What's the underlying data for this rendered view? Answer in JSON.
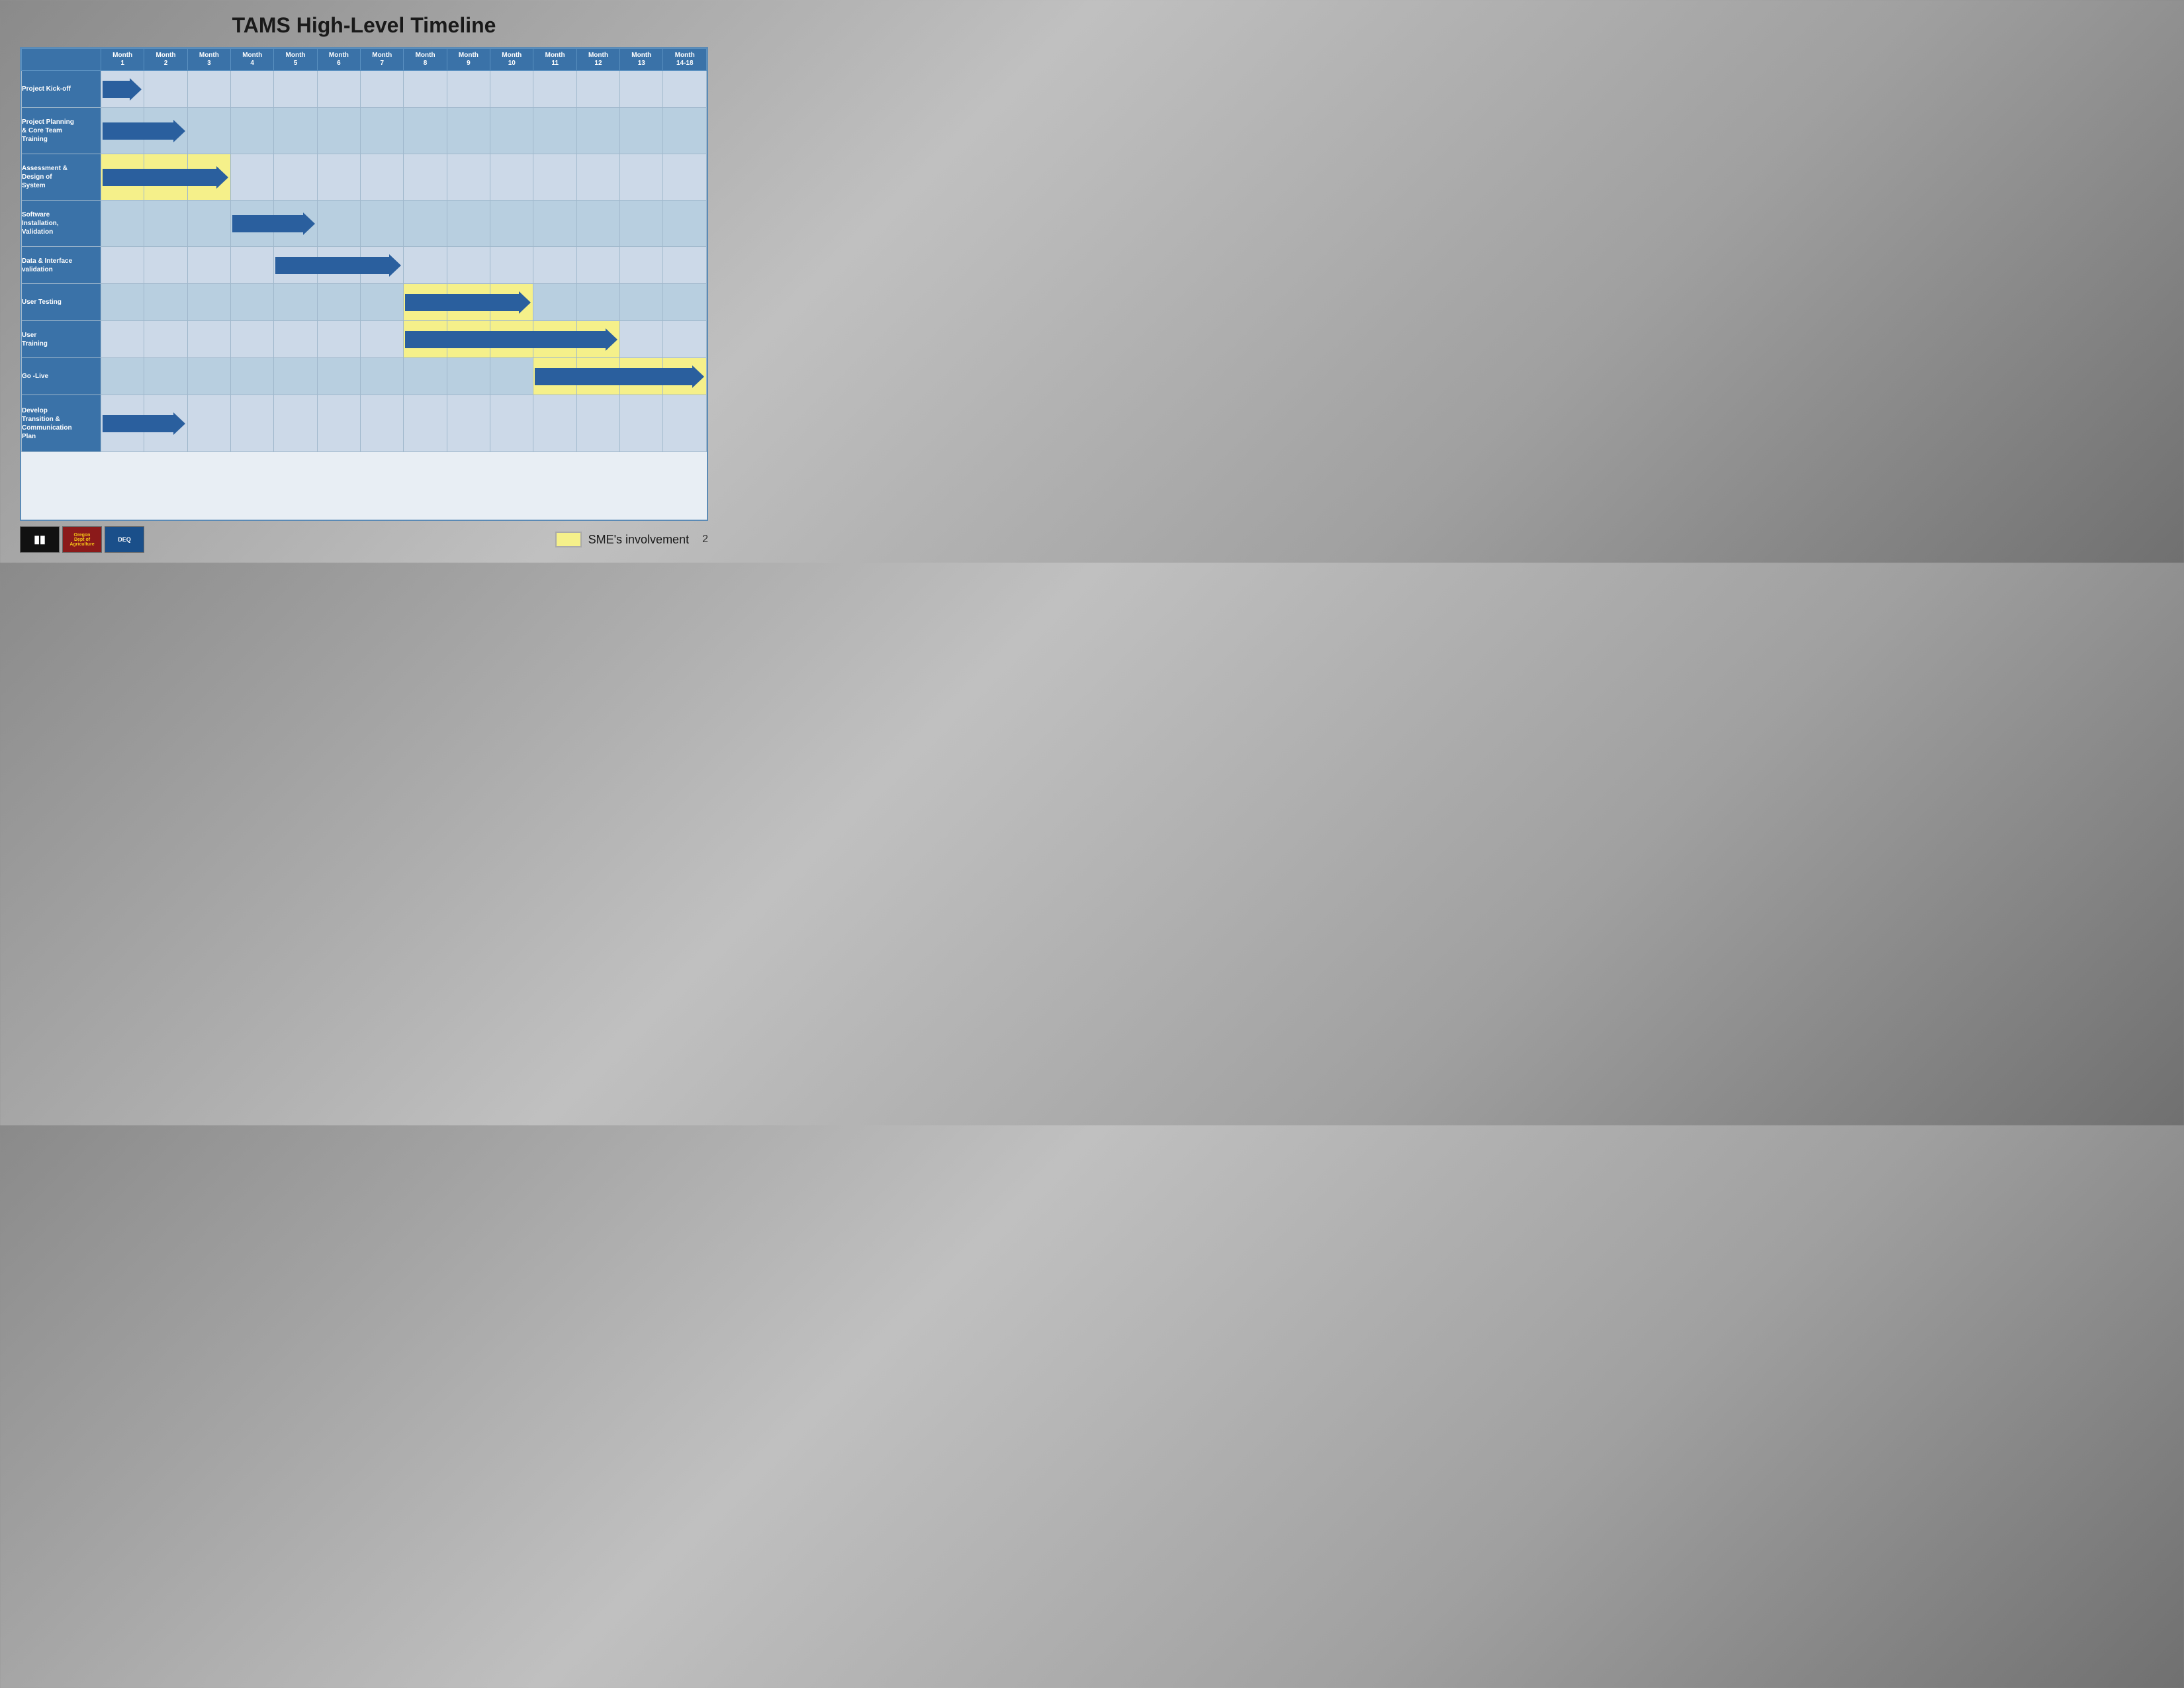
{
  "title": "TAMS High-Level Timeline",
  "months": [
    {
      "label": "Month",
      "sub": "1"
    },
    {
      "label": "Month",
      "sub": "2"
    },
    {
      "label": "Month",
      "sub": "3"
    },
    {
      "label": "Month",
      "sub": "4"
    },
    {
      "label": "Month",
      "sub": "5"
    },
    {
      "label": "Month",
      "sub": "6"
    },
    {
      "label": "Month",
      "sub": "7"
    },
    {
      "label": "Month",
      "sub": "8"
    },
    {
      "label": "Month",
      "sub": "9"
    },
    {
      "label": "Month",
      "sub": "10"
    },
    {
      "label": "Month",
      "sub": "11"
    },
    {
      "label": "Month",
      "sub": "12"
    },
    {
      "label": "Month",
      "sub": "13"
    },
    {
      "label": "Month",
      "sub": "14-18"
    }
  ],
  "rows": [
    {
      "label": "Project Kick-off",
      "arrow_start": 0,
      "arrow_span": 1,
      "yellow": [],
      "height": "normal"
    },
    {
      "label": "Project Planning\n& Core Team\nTraining",
      "arrow_start": 0,
      "arrow_span": 2,
      "yellow": [],
      "height": "tall"
    },
    {
      "label": "Assessment &\nDesign of\nSystem",
      "arrow_start": 0,
      "arrow_span": 3,
      "yellow": [
        0,
        1,
        2
      ],
      "height": "tall"
    },
    {
      "label": "Software\nInstallation,\nValidation",
      "arrow_start": 3,
      "arrow_span": 2,
      "yellow": [],
      "height": "tall"
    },
    {
      "label": "Data & Interface\nvalidation",
      "arrow_start": 4,
      "arrow_span": 3,
      "yellow": [],
      "height": "normal"
    },
    {
      "label": "User Testing",
      "arrow_start": 7,
      "arrow_span": 3,
      "yellow": [
        7,
        8,
        9
      ],
      "height": "normal"
    },
    {
      "label": "User\nTraining",
      "arrow_start": 7,
      "arrow_span": 5,
      "yellow": [
        7,
        8,
        9,
        10,
        11
      ],
      "height": "normal"
    },
    {
      "label": "Go -Live",
      "arrow_start": 10,
      "arrow_span": 4,
      "yellow": [
        10,
        11,
        12,
        13
      ],
      "height": "normal"
    },
    {
      "label": "Develop\nTransition &\nCommunication\nPlan",
      "arrow_start": 0,
      "arrow_span": 2,
      "yellow": [],
      "height": "taller"
    }
  ],
  "legend": {
    "text": "SME's\ninvolvement",
    "color": "#f5f08a"
  },
  "slide_number": "2",
  "logos": [
    {
      "id": "jc",
      "label": "JC"
    },
    {
      "id": "oregon",
      "label": "Oregon\nDept of\nAgriculture"
    },
    {
      "id": "deq",
      "label": "DEQ"
    }
  ]
}
